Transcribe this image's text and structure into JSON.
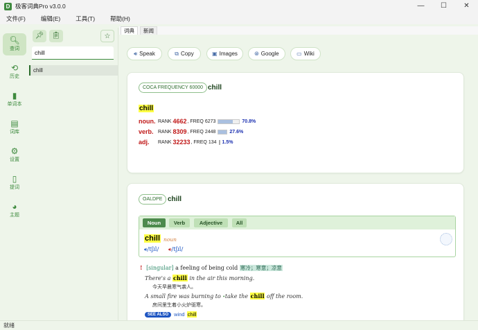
{
  "window": {
    "title": "极客词典Pro v3.0.0",
    "app_icon_letter": "D",
    "minimize": "—",
    "maximize": "☐",
    "close": "✕"
  },
  "menu": [
    "文件(F)",
    "编辑(E)",
    "工具(T)",
    "帮助(H)"
  ],
  "nav": [
    {
      "label": "查词",
      "icon": "search-icon",
      "glyph": "🔍︎"
    },
    {
      "label": "历史",
      "icon": "history-icon",
      "glyph": "⟲"
    },
    {
      "label": "单词本",
      "icon": "book-icon",
      "glyph": "▮"
    },
    {
      "label": "词库",
      "icon": "library-icon",
      "glyph": "▤"
    },
    {
      "label": "设置",
      "icon": "gear-icon",
      "glyph": "⚙"
    },
    {
      "label": "提词",
      "icon": "prompt-icon",
      "glyph": "▯"
    },
    {
      "label": "主题",
      "icon": "palette-icon",
      "glyph": "◕"
    }
  ],
  "list": {
    "pin_glyph": "📌︎",
    "clipboard_glyph": "📋︎",
    "star_glyph": "☆",
    "search_value": "chill",
    "items": [
      "chill"
    ]
  },
  "tabs": [
    "词典",
    "新闻"
  ],
  "actions": [
    {
      "label": "Speak",
      "glyph": "🔊︎"
    },
    {
      "label": "Copy",
      "glyph": "⧉"
    },
    {
      "label": "Images",
      "glyph": "▣"
    },
    {
      "label": "Google",
      "glyph": "🌐︎"
    },
    {
      "label": "Wiki",
      "glyph": "▭"
    }
  ],
  "coca": {
    "tag": "COCA FREQUENCY 60000",
    "headword": "chill",
    "word": "chill",
    "rows": [
      {
        "pos": "noun.",
        "rank_label": "RANK",
        "rank": "4662",
        "freq_label": ", FREQ",
        "freq": "6273",
        "percent": "70.8%",
        "fraction": 0.708
      },
      {
        "pos": "verb.",
        "rank_label": "RANK",
        "rank": "8309",
        "freq_label": ", FREQ",
        "freq": "2448",
        "percent": "27.6%",
        "fraction": 0.276
      },
      {
        "pos": "adj.",
        "rank_label": "RANK",
        "rank": "32233",
        "freq_label": ", FREQ",
        "freq": "134",
        "percent": "1.5%",
        "fraction": 0.015
      }
    ]
  },
  "oald": {
    "tag": "OALDPE",
    "headword": "chill",
    "pos_tabs": [
      "Noun",
      "Verb",
      "Adjective",
      "All"
    ],
    "entry_word": "chill",
    "entry_pos": "noun",
    "pron_uk_speaker": "🔊︎",
    "pron_uk": "/tʃɪl/",
    "pron_us_speaker": "🔊︎",
    "pron_us": "/tʃɪl/",
    "sense": {
      "marker": "!",
      "grammar": "[singular]",
      "definition": "a feeling of being cold",
      "chinese": "寒冷；寒意；凉意"
    },
    "examples": [
      {
        "pre": "There's a",
        "word": "chill",
        "post": "in the air this morning.",
        "cn": "今天早晨寒气袭人。"
      },
      {
        "pre": "A small fire was burning to",
        "dot": "•",
        "mid": "take the",
        "word": "chill",
        "post": "off the room.",
        "cn": "房间里生着小火炉驱寒。"
      }
    ],
    "see_also": {
      "badge": "SEE ALSO",
      "link": "wind",
      "word": "chill"
    }
  },
  "status": "就绪"
}
